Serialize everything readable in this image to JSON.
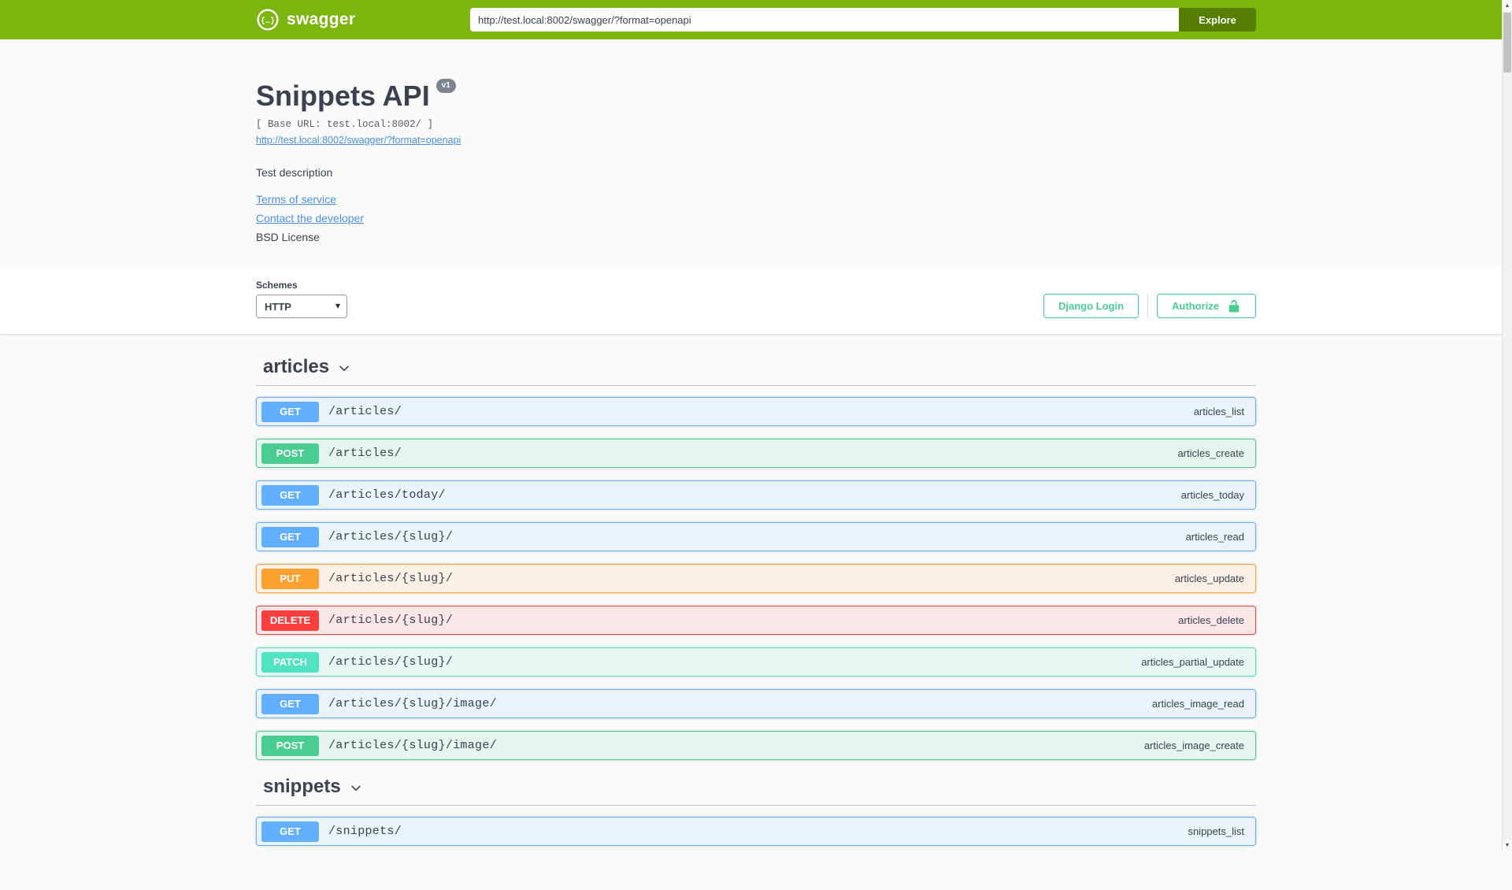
{
  "topbar": {
    "brand": "swagger",
    "url_value": "http://test.local:8002/swagger/?format=openapi",
    "explore_label": "Explore"
  },
  "info": {
    "title": "Snippets API",
    "version": "v1",
    "base_url": "[ Base URL: test.local:8002/ ]",
    "spec_link": "http://test.local:8002/swagger/?format=openapi",
    "description": "Test description",
    "terms_label": "Terms of service",
    "contact_label": "Contact the developer",
    "license_label": "BSD License"
  },
  "scheme": {
    "label": "Schemes",
    "selected": "HTTP",
    "django_login_label": "Django Login",
    "authorize_label": "Authorize"
  },
  "icons": {
    "caret": "▾",
    "scroll_up": "▲",
    "scroll_down": "▼"
  },
  "colors": {
    "topbar-bg": "#7cb50e",
    "explore-btn": "#547f00",
    "get": "#61affe",
    "post": "#49cc90",
    "put": "#fca130",
    "delete": "#f93e3e",
    "patch": "#50e3c2",
    "authorize": "#49cc90",
    "link": "#4990e2",
    "text": "#3b4151"
  },
  "sections": [
    {
      "name": "articles",
      "operations": [
        {
          "method": "GET",
          "path": "/articles/",
          "opid": "articles_list"
        },
        {
          "method": "POST",
          "path": "/articles/",
          "opid": "articles_create"
        },
        {
          "method": "GET",
          "path": "/articles/today/",
          "opid": "articles_today"
        },
        {
          "method": "GET",
          "path": "/articles/{slug}/",
          "opid": "articles_read"
        },
        {
          "method": "PUT",
          "path": "/articles/{slug}/",
          "opid": "articles_update"
        },
        {
          "method": "DELETE",
          "path": "/articles/{slug}/",
          "opid": "articles_delete"
        },
        {
          "method": "PATCH",
          "path": "/articles/{slug}/",
          "opid": "articles_partial_update"
        },
        {
          "method": "GET",
          "path": "/articles/{slug}/image/",
          "opid": "articles_image_read"
        },
        {
          "method": "POST",
          "path": "/articles/{slug}/image/",
          "opid": "articles_image_create"
        }
      ]
    },
    {
      "name": "snippets",
      "operations": [
        {
          "method": "GET",
          "path": "/snippets/",
          "opid": "snippets_list"
        }
      ]
    }
  ]
}
